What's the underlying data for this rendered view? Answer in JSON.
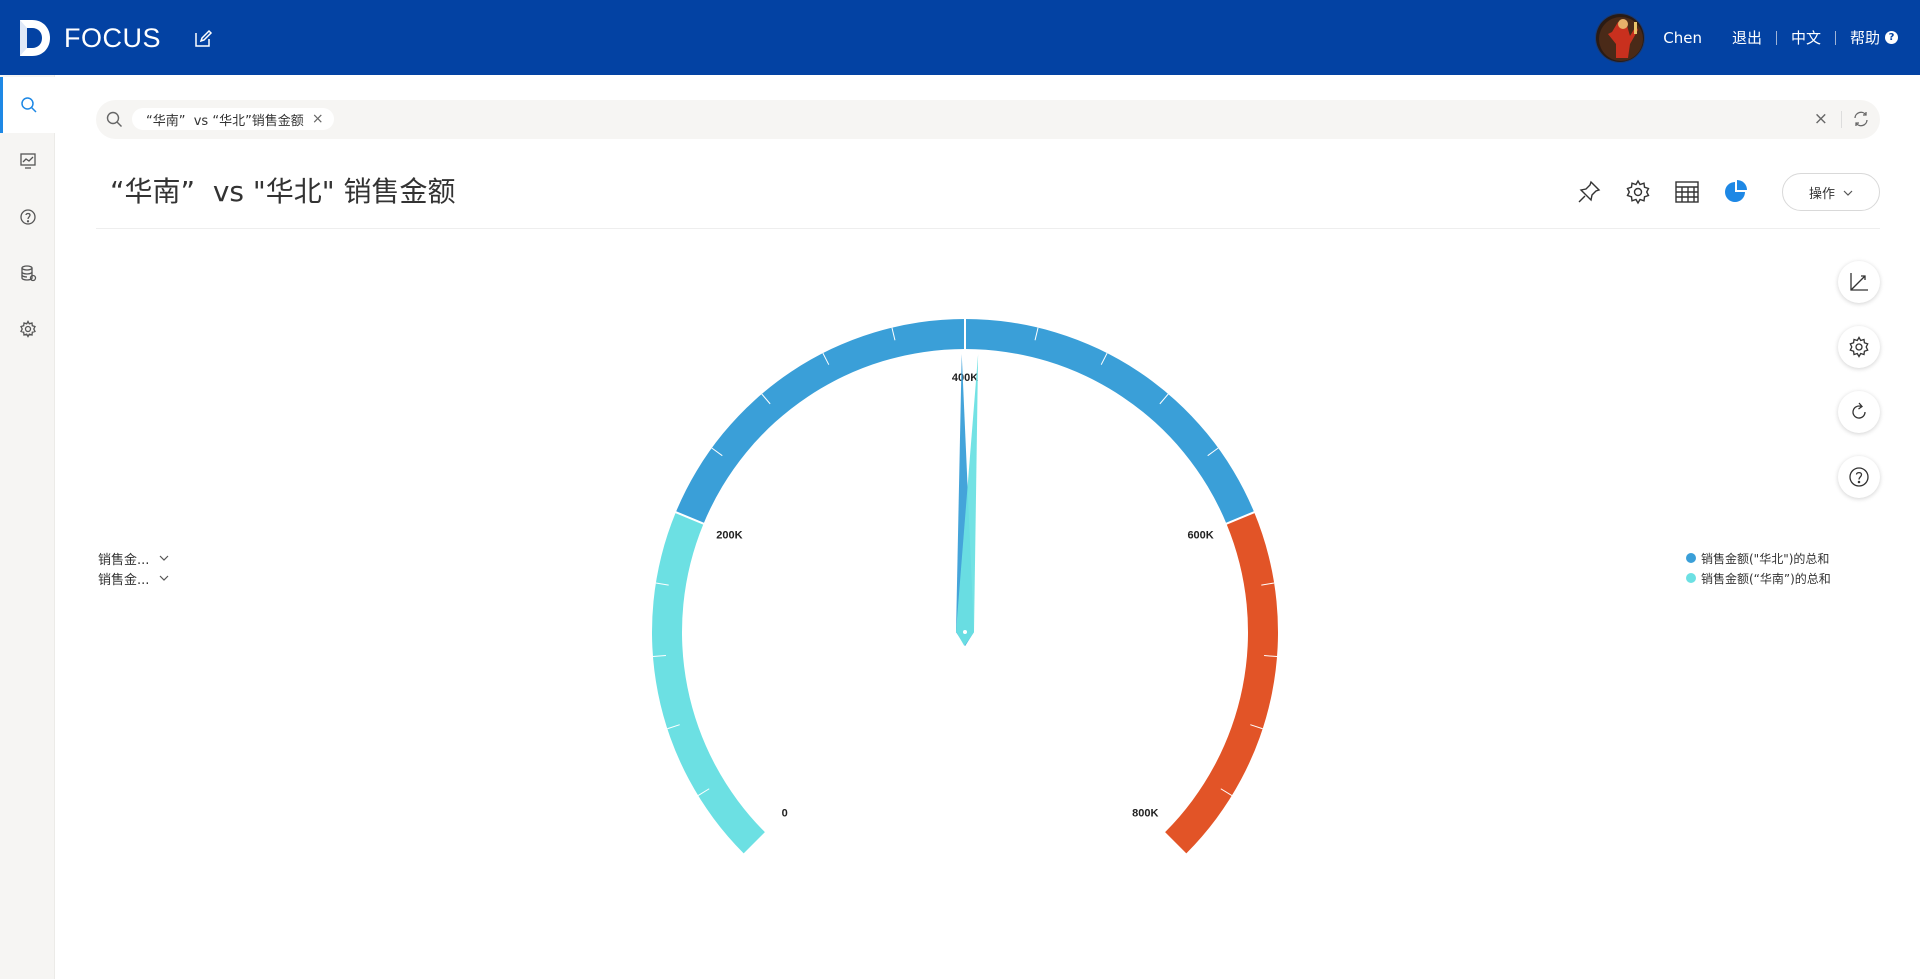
{
  "header": {
    "logo_text": "FOCUS",
    "user_name": "Chen",
    "logout": "退出",
    "language": "中文",
    "help": "帮助",
    "help_icon": "question-circle-icon"
  },
  "sidebar": {
    "items": [
      {
        "icon": "search-icon",
        "active": true
      },
      {
        "icon": "dashboard-icon",
        "active": false
      },
      {
        "icon": "question-icon",
        "active": false
      },
      {
        "icon": "database-icon",
        "active": false
      },
      {
        "icon": "gear-icon",
        "active": false
      }
    ]
  },
  "search": {
    "token": "“华南”  vs “华北”销售金额"
  },
  "title": "“华南”  vs \"华北\" 销售金额",
  "toolbar": {
    "ops_label": "操作",
    "icons": [
      "pin-icon",
      "gear-icon",
      "table-icon",
      "pie-chart-icon"
    ]
  },
  "side_tools": [
    "axis-icon",
    "gear-icon",
    "refresh-icon",
    "help-icon"
  ],
  "measures": [
    {
      "label": "销售金..."
    },
    {
      "label": "销售金..."
    }
  ],
  "legend": [
    {
      "label": "销售金额(\"华北\")的总和",
      "color": "#3a9fd8"
    },
    {
      "label": "销售金额(“华南”)的总和",
      "color": "#6ce0e3"
    }
  ],
  "colors": {
    "header_bg": "#0342a3",
    "accent": "#1e88e5",
    "gauge_low": "#6ce0e3",
    "gauge_mid": "#3a9fd8",
    "gauge_high": "#e25427"
  },
  "chart_data": {
    "type": "gauge",
    "min": 0,
    "max": 800000,
    "tick_labels": [
      "0",
      "200K",
      "400K",
      "600K",
      "800K"
    ],
    "bands": [
      {
        "from": 0,
        "to": 200000,
        "color": "#6ce0e3"
      },
      {
        "from": 200000,
        "to": 600000,
        "color": "#3a9fd8"
      },
      {
        "from": 600000,
        "to": 800000,
        "color": "#e25427"
      }
    ],
    "series": [
      {
        "name": "销售金额(\"华北\")的总和",
        "value": 398000,
        "color": "#3a9fd8"
      },
      {
        "name": "销售金额(“华南”)的总和",
        "value": 408000,
        "color": "#6ce0e3"
      }
    ]
  }
}
